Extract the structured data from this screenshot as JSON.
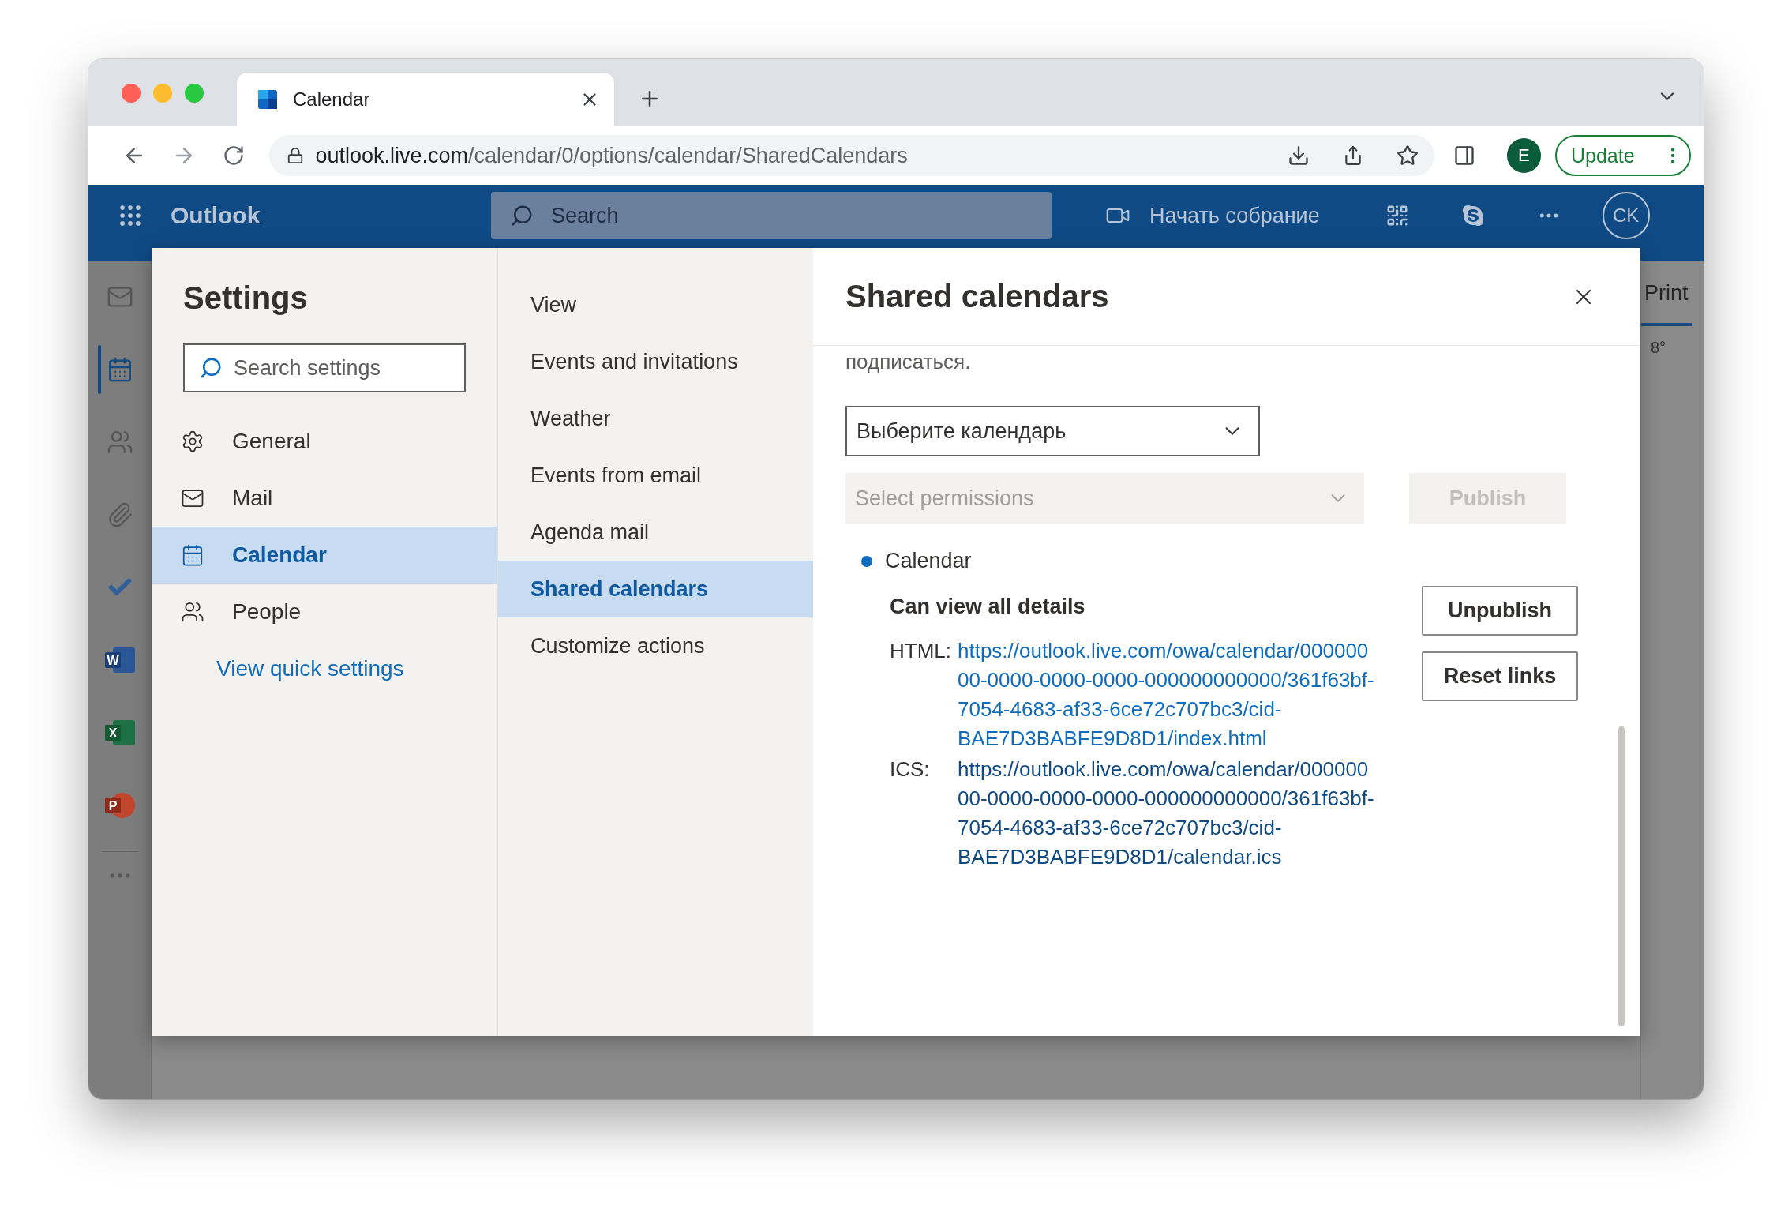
{
  "browser": {
    "tab": {
      "title": "Calendar"
    },
    "url": {
      "host": "outlook.live.com",
      "path": "/calendar/0/options/calendar/SharedCalendars"
    },
    "profile_initial": "E",
    "update_button": "Update"
  },
  "app_bar": {
    "app_name": "Outlook",
    "search_placeholder": "Search",
    "meet_now": "Начать собрание",
    "avatar_initials": "CK"
  },
  "nav_rail": [
    {
      "kind": "mail",
      "selected": false
    },
    {
      "kind": "calendar",
      "selected": true
    },
    {
      "kind": "people",
      "selected": false
    },
    {
      "kind": "files",
      "selected": false
    },
    {
      "kind": "todo",
      "selected": false
    },
    {
      "kind": "word",
      "letter": "W",
      "selected": false
    },
    {
      "kind": "excel",
      "letter": "X",
      "selected": false
    },
    {
      "kind": "powerpoint",
      "letter": "P",
      "selected": false
    },
    {
      "kind": "more",
      "selected": false
    }
  ],
  "background": {
    "print": "Print",
    "temperature": "8°"
  },
  "settings": {
    "title": "Settings",
    "search_placeholder": "Search settings",
    "categories": [
      {
        "kind": "general",
        "label": "General",
        "selected": false
      },
      {
        "kind": "mail",
        "label": "Mail",
        "selected": false
      },
      {
        "kind": "calendar",
        "label": "Calendar",
        "selected": true
      },
      {
        "kind": "people",
        "label": "People",
        "selected": false
      }
    ],
    "quick_settings_link": "View quick settings",
    "subcategories": [
      {
        "label": "View",
        "selected": false
      },
      {
        "label": "Events and invitations",
        "selected": false
      },
      {
        "label": "Weather",
        "selected": false
      },
      {
        "label": "Events from email",
        "selected": false
      },
      {
        "label": "Agenda mail",
        "selected": false
      },
      {
        "label": "Shared calendars",
        "selected": true
      },
      {
        "label": "Customize actions",
        "selected": false
      }
    ]
  },
  "panel": {
    "title": "Shared calendars",
    "intro_tail": "подписаться.",
    "calendar_select": {
      "value": "Выберите календарь"
    },
    "permissions_select": {
      "placeholder": "Select permissions",
      "disabled": true
    },
    "publish_button": {
      "label": "Publish",
      "disabled": true
    },
    "published": [
      {
        "name": "Calendar",
        "permission": "Can view all details",
        "links": [
          {
            "label": "HTML:",
            "url": "https://outlook.live.com/owa/calendar/00000000-0000-0000-0000-000000000000/361f63bf-7054-4683-af33-6ce72c707bc3/cid-BAE7D3BABFE9D8D1/index.html",
            "visited": false
          },
          {
            "label": "ICS:",
            "url": "https://outlook.live.com/owa/calendar/00000000-0000-0000-0000-000000000000/361f63bf-7054-4683-af33-6ce72c707bc3/cid-BAE7D3BABFE9D8D1/calendar.ics",
            "visited": true
          }
        ]
      }
    ],
    "actions": [
      "Unpublish",
      "Reset links"
    ]
  }
}
